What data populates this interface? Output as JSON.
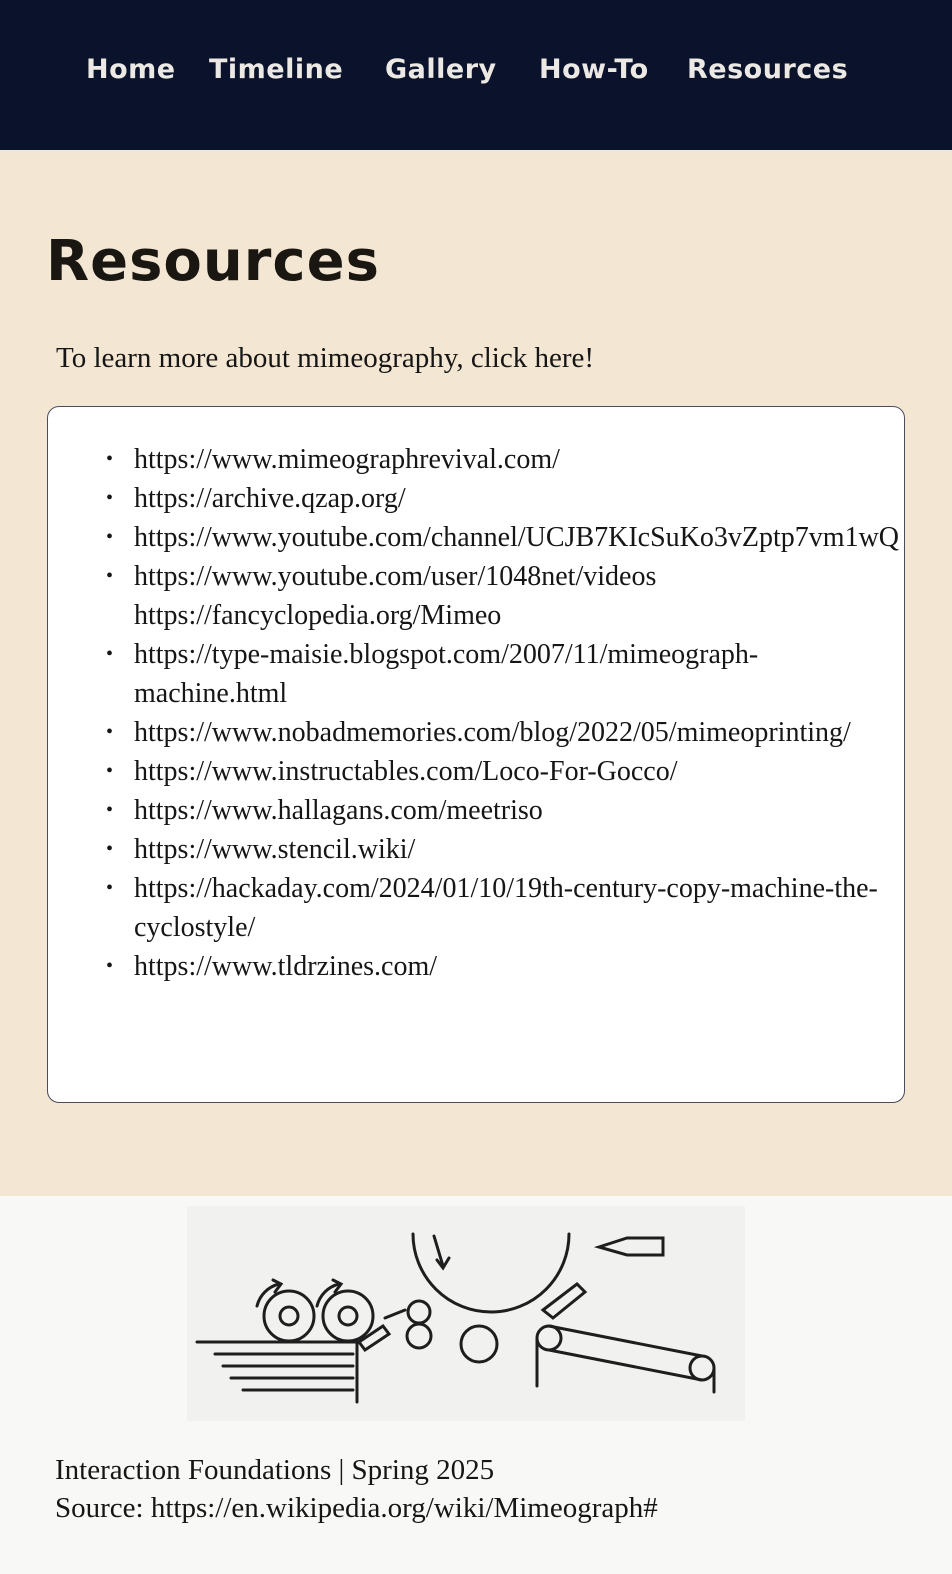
{
  "nav": {
    "items": [
      {
        "label": "Home"
      },
      {
        "label": "Timeline"
      },
      {
        "label": "Gallery"
      },
      {
        "label": "How-To"
      },
      {
        "label": "Resources"
      }
    ]
  },
  "page": {
    "title": "Resources",
    "intro": "To learn more about mimeography, click here!"
  },
  "resources": [
    "https://www.mimeographrevival.com/",
    "https://archive.qzap.org/",
    "https://www.youtube.com/channel/UCJB7KIcSuKo3vZptp7vm1wQ",
    "https://www.youtube.com/user/1048net/videos https://fancyclopedia.org/Mimeo",
    "https://type-maisie.blogspot.com/2007/11/mimeograph-machine.html",
    "https://www.nobadmemories.com/blog/2022/05/mimeoprinting/",
    "https://www.instructables.com/Loco-For-Gocco/",
    "https://www.hallagans.com/meetriso",
    "https://www.stencil.wiki/",
    "https://hackaday.com/2024/01/10/19th-century-copy-machine-the-cyclostyle/",
    "https://www.tldrzines.com/"
  ],
  "footer": {
    "course": "Interaction Foundations | Spring 2025",
    "source": "Source: https://en.wikipedia.org/wiki/Mimeograph#"
  },
  "colors": {
    "nav_background": "#0b132c",
    "page_background": "#f3e6d2",
    "card_background": "#ffffff",
    "footer_background": "#f8f8f6"
  }
}
